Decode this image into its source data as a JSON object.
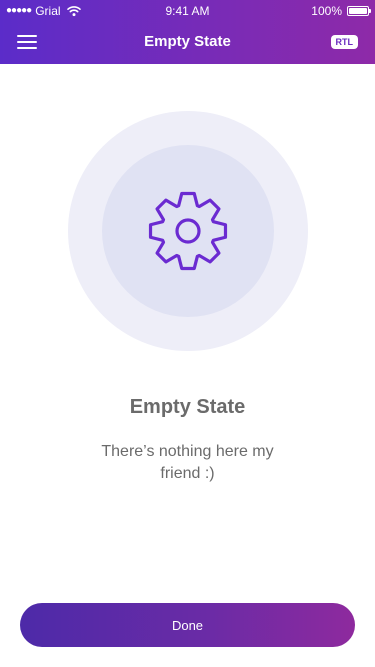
{
  "status_bar": {
    "signal_dots": "●●●●●",
    "carrier": "Grial",
    "time": "9:41 AM",
    "battery_percent": "100%",
    "battery_level": 1.0
  },
  "navbar": {
    "title": "Empty State",
    "rtl_label": "RTL",
    "menu_icon": "hamburger-icon"
  },
  "empty_state": {
    "icon": "gear-icon",
    "title": "Empty State",
    "message": "There’s nothing here my friend :)"
  },
  "actions": {
    "done_label": "Done"
  },
  "colors": {
    "accent": "#6b2bd1",
    "gradient_start": "#5b2cc9",
    "gradient_end": "#8e2aa8",
    "text_gray": "#6b6b6b",
    "circle_outer": "#eeeef8",
    "circle_inner": "#e0e2f3"
  }
}
